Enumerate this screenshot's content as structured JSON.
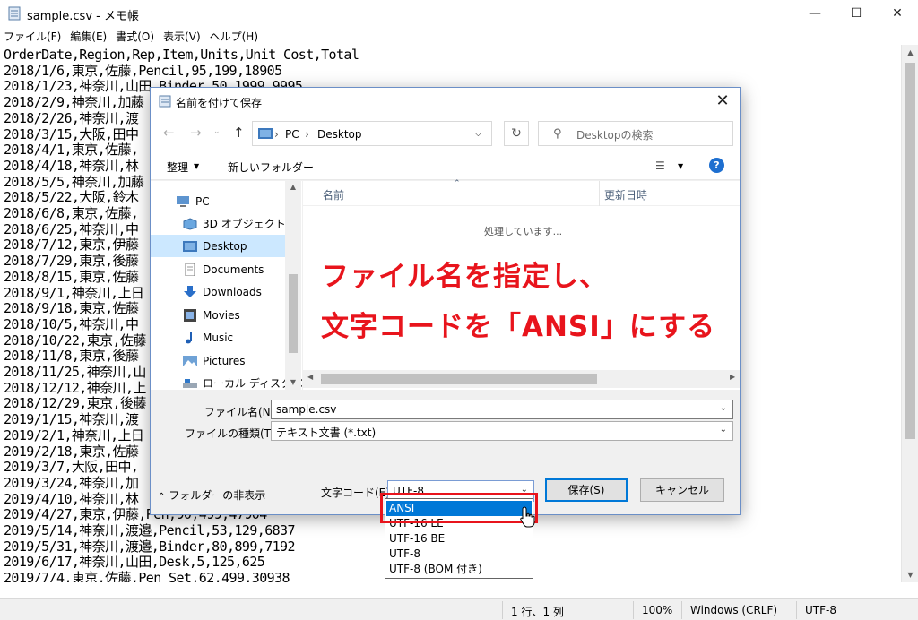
{
  "notepad": {
    "title": "sample.csv - メモ帳",
    "menu": [
      "ファイル(F)",
      "編集(E)",
      "書式(O)",
      "表示(V)",
      "ヘルプ(H)"
    ],
    "lines": [
      "OrderDate,Region,Rep,Item,Units,Unit Cost,Total",
      "2018/1/6,東京,佐藤,Pencil,95,199,18905",
      "2018/1/23,神奈川,山田,Binder,50,1999,9995",
      "2018/2/9,神奈川,加藤",
      "2018/2/26,神奈川,渡",
      "2018/3/15,大阪,田中",
      "2018/4/1,東京,佐藤,",
      "2018/4/18,神奈川,林",
      "2018/5/5,神奈川,加藤",
      "2018/5/22,大阪,鈴木",
      "2018/6/8,東京,佐藤,",
      "2018/6/25,神奈川,中",
      "2018/7/12,東京,伊藤",
      "2018/7/29,東京,後藤",
      "2018/8/15,東京,佐藤",
      "2018/9/1,神奈川,上日",
      "2018/9/18,東京,佐藤",
      "2018/10/5,神奈川,中",
      "2018/10/22,東京,佐藤",
      "2018/11/8,東京,後藤",
      "2018/11/25,神奈川,山",
      "2018/12/12,神奈川,上",
      "2018/12/29,東京,後藤",
      "2019/1/15,神奈川,渡",
      "2019/2/1,神奈川,上日",
      "2019/2/18,東京,佐藤",
      "2019/3/7,大阪,田中,",
      "2019/3/24,神奈川,加",
      "2019/4/10,神奈川,林",
      "2019/4/27,東京,伊藤,Pen,90,499,47904",
      "2019/5/14,神奈川,渡邉,Pencil,53,129,6837",
      "2019/5/31,神奈川,渡邉,Binder,80,899,7192",
      "2019/6/17,神奈川,山田,Desk,5,125,625",
      "2019/7/4,東京,佐藤,Pen Set,62,499,30938"
    ],
    "status": {
      "position": "1 行、1 列",
      "zoom": "100%",
      "line_ending": "Windows (CRLF)",
      "encoding": "UTF-8"
    }
  },
  "dialog": {
    "title": "名前を付けて保存",
    "address": [
      "PC",
      "Desktop"
    ],
    "search_placeholder": "Desktopの検索",
    "toolbar": {
      "organize": "整理",
      "new_folder": "新しいフォルダー"
    },
    "tree": [
      "PC",
      "3D オブジェクト",
      "Desktop",
      "Documents",
      "Downloads",
      "Movies",
      "Music",
      "Pictures",
      "ローカル ディスク (C"
    ],
    "columns": {
      "name": "名前",
      "date": "更新日時"
    },
    "processing": "処理しています...",
    "filename_label": "ファイル名(N):",
    "filename_value": "sample.csv",
    "filetype_label": "ファイルの種類(T):",
    "filetype_value": "テキスト文書 (*.txt)",
    "hide_folders": "フォルダーの非表示",
    "encoding_label": "文字コード(E):",
    "encoding_value": "UTF-8",
    "save_button": "保存(S)",
    "cancel_button": "キャンセル",
    "encoding_options": [
      "ANSI",
      "UTF-16 LE",
      "UTF-16 BE",
      "UTF-8",
      "UTF-8 (BOM 付き)"
    ]
  },
  "annotation": {
    "line1": "ファイル名を指定し、",
    "line2": "文字コードを「ANSI」にする"
  },
  "colors": {
    "annotation": "#e8141c",
    "selection": "#0078d7",
    "tree_selection": "#cce8ff"
  }
}
